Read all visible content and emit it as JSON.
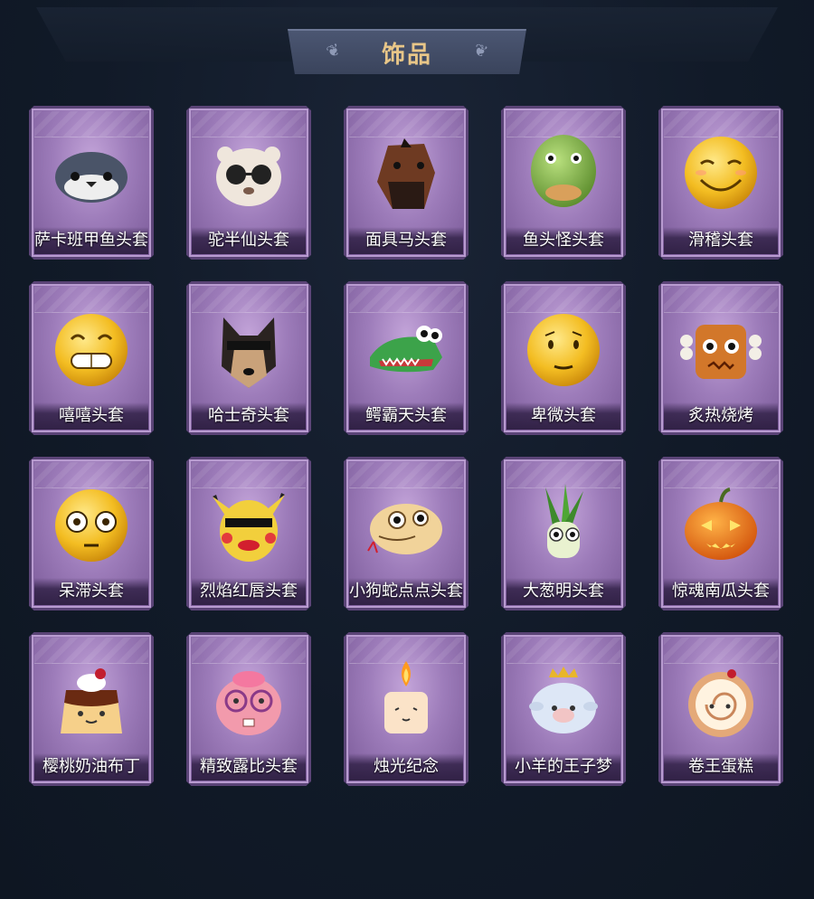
{
  "title": "饰品",
  "items": [
    {
      "name": "萨卡班甲鱼头套",
      "icon": "fish-mask-icon"
    },
    {
      "name": "驼半仙头套",
      "icon": "alpaca-sunglasses-mask-icon"
    },
    {
      "name": "面具马头套",
      "icon": "horse-mask-icon"
    },
    {
      "name": "鱼头怪头套",
      "icon": "fish-head-mask-icon"
    },
    {
      "name": "滑稽头套",
      "icon": "funny-face-mask-icon"
    },
    {
      "name": "嘻嘻头套",
      "icon": "grin-face-mask-icon"
    },
    {
      "name": "哈士奇头套",
      "icon": "husky-mask-icon"
    },
    {
      "name": "鳄霸天头套",
      "icon": "crocodile-mask-icon"
    },
    {
      "name": "卑微头套",
      "icon": "humble-face-mask-icon"
    },
    {
      "name": "炙热烧烤",
      "icon": "bbq-meat-mask-icon"
    },
    {
      "name": "呆滞头套",
      "icon": "dazed-face-mask-icon"
    },
    {
      "name": "烈焰红唇头套",
      "icon": "pikachu-lips-mask-icon"
    },
    {
      "name": "小狗蛇点点头套",
      "icon": "snake-mask-icon"
    },
    {
      "name": "大葱明头套",
      "icon": "scallion-mask-icon"
    },
    {
      "name": "惊魂南瓜头套",
      "icon": "pumpkin-mask-icon"
    },
    {
      "name": "樱桃奶油布丁",
      "icon": "cherry-pudding-mask-icon"
    },
    {
      "name": "精致露比头套",
      "icon": "ruby-beaver-mask-icon"
    },
    {
      "name": "烛光纪念",
      "icon": "candle-mask-icon"
    },
    {
      "name": "小羊的王子梦",
      "icon": "sheep-prince-mask-icon"
    },
    {
      "name": "卷王蛋糕",
      "icon": "roll-cake-mask-icon"
    }
  ],
  "colors": {
    "background": "#111a28",
    "card": "#9d7cba",
    "title": "#e8c688",
    "label": "#ffffff"
  }
}
